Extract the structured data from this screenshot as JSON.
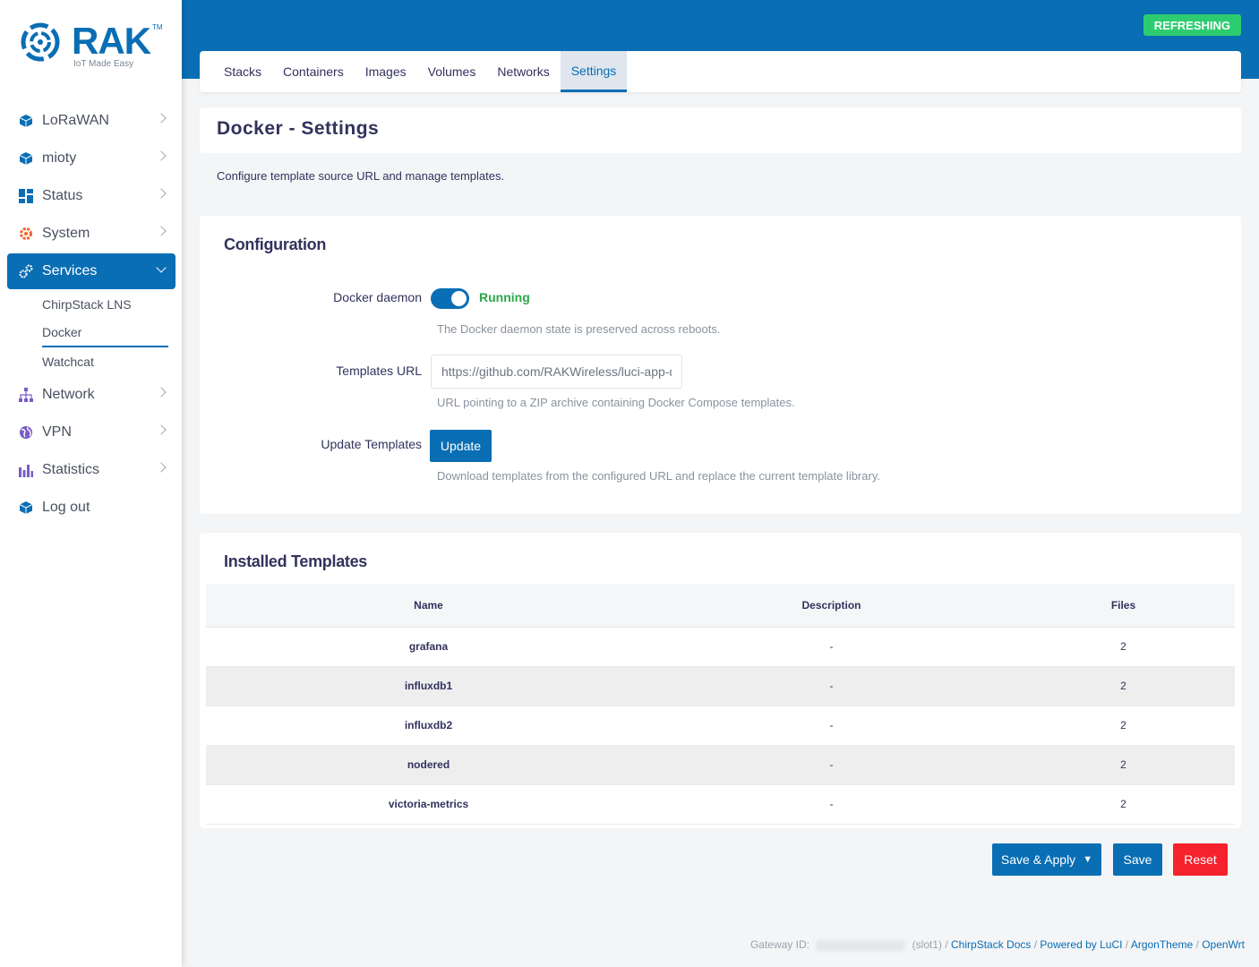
{
  "brand": {
    "name": "RAK",
    "tm": "TM",
    "tagline": "IoT Made Easy",
    "color": "#0a6eb4"
  },
  "sidebar": {
    "items": [
      {
        "label": "LoRaWAN",
        "icon": "cube-icon"
      },
      {
        "label": "mioty",
        "icon": "cube-icon"
      },
      {
        "label": "Status",
        "icon": "dashboard-icon"
      },
      {
        "label": "System",
        "icon": "gear-icon"
      },
      {
        "label": "Services",
        "icon": "gears-icon",
        "active": true
      },
      {
        "label": "Network",
        "icon": "network-icon"
      },
      {
        "label": "VPN",
        "icon": "globe-icon"
      },
      {
        "label": "Statistics",
        "icon": "bar-chart-icon"
      },
      {
        "label": "Log out",
        "icon": "cube-icon"
      }
    ],
    "services_sub": [
      {
        "label": "ChirpStack LNS"
      },
      {
        "label": "Docker",
        "current": true
      },
      {
        "label": "Watchcat"
      }
    ]
  },
  "header": {
    "status_badge": "REFRESHING",
    "badge_color": "#2ecc71"
  },
  "tabs": [
    {
      "label": "Stacks"
    },
    {
      "label": "Containers"
    },
    {
      "label": "Images"
    },
    {
      "label": "Volumes"
    },
    {
      "label": "Networks"
    },
    {
      "label": "Settings",
      "active": true
    }
  ],
  "page": {
    "title": "Docker - Settings",
    "description": "Configure template source URL and manage templates."
  },
  "configuration": {
    "heading": "Configuration",
    "daemon": {
      "label": "Docker daemon",
      "state": "Running",
      "enabled": true,
      "hint": "The Docker daemon state is preserved across reboots."
    },
    "templates_url": {
      "label": "Templates URL",
      "value": "https://github.com/RAKWireless/luci-app-docker-templates",
      "hint": "URL pointing to a ZIP archive containing Docker Compose templates."
    },
    "update": {
      "label": "Update Templates",
      "button": "Update",
      "hint": "Download templates from the configured URL and replace the current template library."
    }
  },
  "installed": {
    "heading": "Installed Templates",
    "columns": [
      "Name",
      "Description",
      "Files"
    ],
    "rows": [
      {
        "name": "grafana",
        "description": "-",
        "files": "2"
      },
      {
        "name": "influxdb1",
        "description": "-",
        "files": "2"
      },
      {
        "name": "influxdb2",
        "description": "-",
        "files": "2"
      },
      {
        "name": "nodered",
        "description": "-",
        "files": "2"
      },
      {
        "name": "victoria-metrics",
        "description": "-",
        "files": "2"
      }
    ]
  },
  "actions": {
    "save_apply": "Save & Apply",
    "save": "Save",
    "reset": "Reset",
    "reset_color": "#f5222d"
  },
  "footer": {
    "gateway_label": "Gateway ID:",
    "slot": "(slot1) /",
    "links": [
      "ChirpStack Docs",
      "Powered by LuCI",
      "ArgonTheme",
      "OpenWrt"
    ]
  }
}
